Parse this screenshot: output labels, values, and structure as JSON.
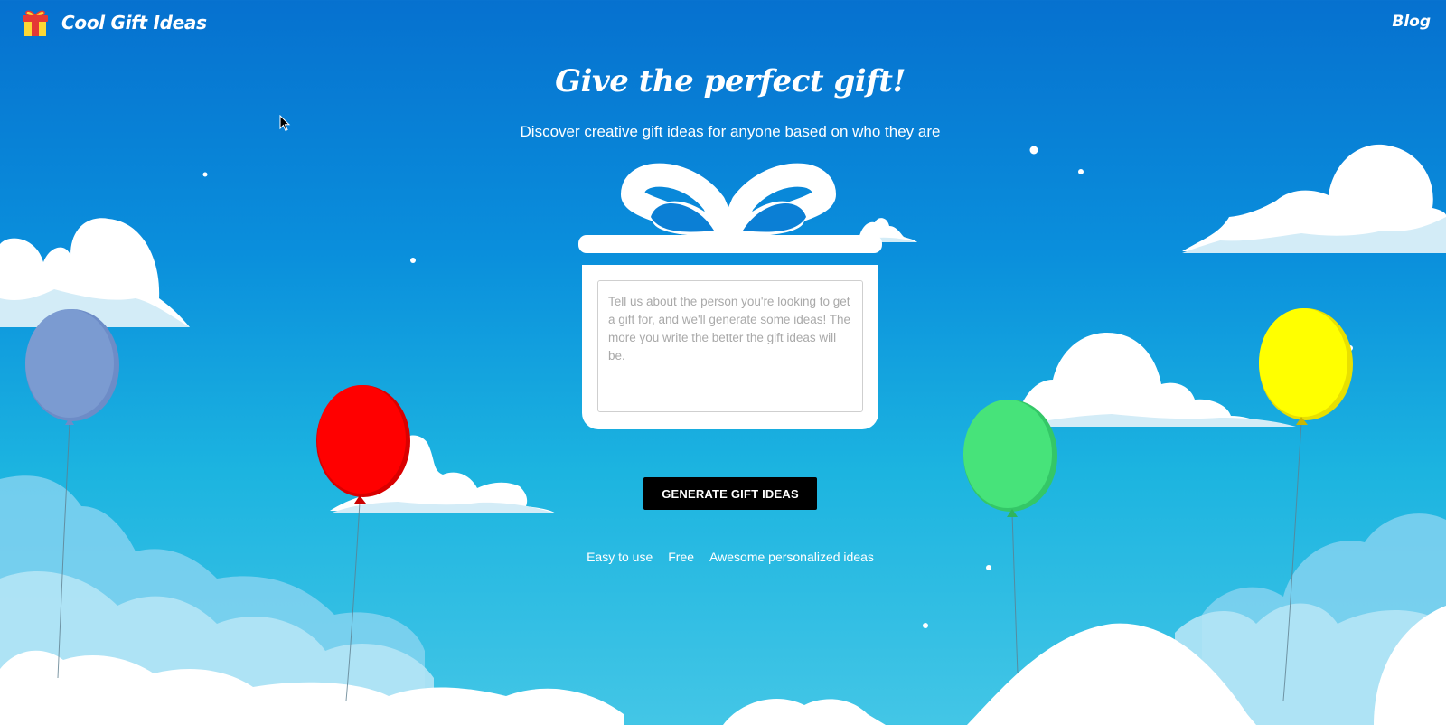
{
  "header": {
    "brand": "Cool Gift Ideas",
    "blog_label": "Blog"
  },
  "hero": {
    "title": "Give the perfect gift!",
    "subtitle": "Discover creative gift ideas for anyone based on who they are"
  },
  "form": {
    "placeholder": "Tell us about the person you're looking to get a gift for, and we'll generate some ideas! The more you write the better the gift ideas will be.",
    "value": "",
    "button_label": "GENERATE GIFT IDEAS"
  },
  "features": [
    "Easy to use",
    "Free",
    "Awesome personalized ideas"
  ],
  "colors": {
    "sky_top": "#0671cf",
    "sky_bottom": "#43c6e6",
    "button_bg": "#000000",
    "balloon_blue": "#7b9bd1",
    "balloon_red": "#ff0000",
    "balloon_green": "#47e37a",
    "balloon_yellow": "#ffff00",
    "logo_red": "#e53935",
    "logo_yellow": "#fdd835"
  },
  "icons": {
    "logo": "gift-box-icon",
    "cursor": "mouse-pointer-icon"
  }
}
